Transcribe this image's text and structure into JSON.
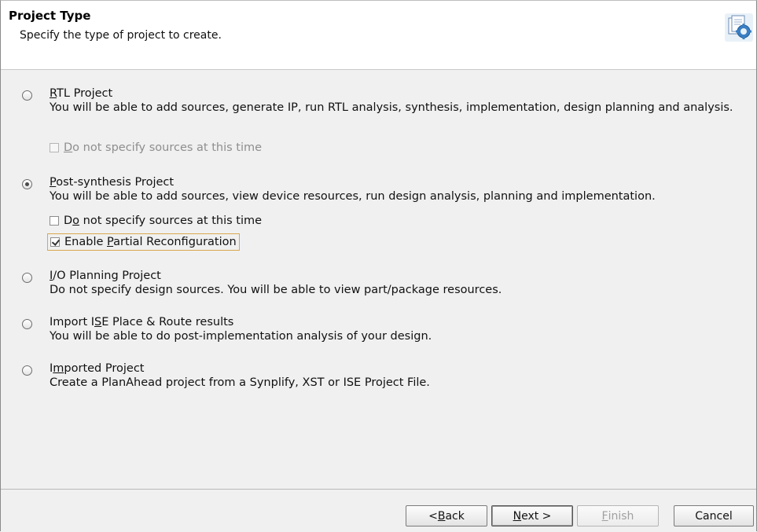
{
  "header": {
    "title": "Project Type",
    "subtitle": "Specify the type of project to create.",
    "icon": "project-wizard-icon"
  },
  "options": [
    {
      "title_pre": "",
      "title_mn": "R",
      "title_post": "TL Project",
      "desc": "You will be able to add sources, generate IP, run RTL analysis, synthesis, implementation, design planning and analysis.",
      "selected": false
    },
    {
      "title_pre": "",
      "title_mn": "P",
      "title_post": "ost-synthesis Project",
      "desc": "You will be able to add sources, view device resources, run design analysis, planning and implementation.",
      "selected": true
    },
    {
      "title_pre": "",
      "title_mn": "I",
      "title_post": "/O Planning Project",
      "desc": "Do not specify design sources. You will be able to view part/package resources.",
      "selected": false
    },
    {
      "title_pre": "Import I",
      "title_mn": "S",
      "title_post": "E Place & Route results",
      "desc": "You will be able to do post-implementation analysis of your design.",
      "selected": false
    },
    {
      "title_pre": "I",
      "title_mn": "m",
      "title_post": "ported Project",
      "desc": "Create a PlanAhead project from a Synplify, XST or ISE Project File.",
      "selected": false
    }
  ],
  "checks": {
    "rtl_no_sources": {
      "pre": "",
      "mn": "D",
      "post": "o not specify sources at this time",
      "checked": false,
      "enabled": false
    },
    "post_no_sources": {
      "pre": "D",
      "mn": "o",
      "post": " not specify sources at this time",
      "checked": false,
      "enabled": true
    },
    "partial_reconfig": {
      "pre": "Enable ",
      "mn": "P",
      "post": "artial Reconfiguration",
      "checked": true,
      "enabled": true
    }
  },
  "buttons": {
    "back": {
      "pre": "< ",
      "mn": "B",
      "post": "ack"
    },
    "next": {
      "pre": "",
      "mn": "N",
      "post": "ext >"
    },
    "finish": {
      "pre": "",
      "mn": "F",
      "post": "inish"
    },
    "cancel": {
      "label": "Cancel"
    }
  }
}
